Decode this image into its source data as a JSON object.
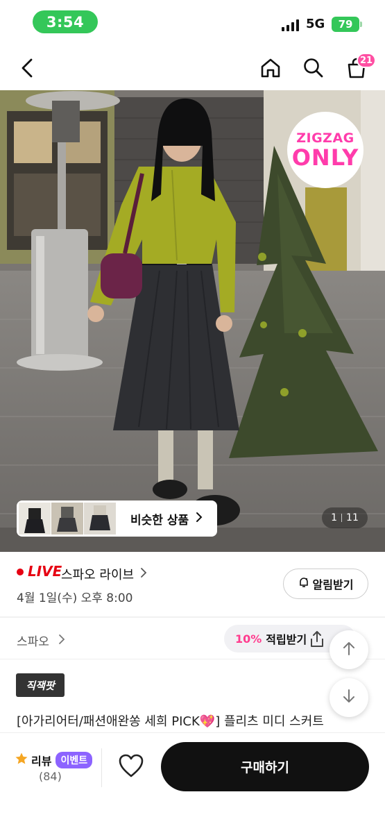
{
  "status_bar": {
    "time": "3:54",
    "network": "5G",
    "battery": "79"
  },
  "nav": {
    "cart_count": "21"
  },
  "hero": {
    "zigzag_line1": "ZIGZAG",
    "zigzag_line2": "ONLY",
    "similar_label": "비슷한 상품",
    "pager_current": "1",
    "pager_total": "11"
  },
  "live": {
    "tag": "LIVE",
    "title": "스파오 라이브",
    "date": "4월 1일(수) 오후 8:00",
    "alarm_label": "알림받기"
  },
  "brand": {
    "name": "스파오",
    "points_percent": "10%",
    "points_label": "적립받기"
  },
  "product": {
    "badge": "직잭팟",
    "name": "[아가리어터/패션애완쏭 세희 PICK💖] 플리츠 미디 스커트"
  },
  "bottom": {
    "review_label": "리뷰",
    "event_label": "이벤트",
    "review_count": "(84)",
    "buy_label": "구매하기"
  },
  "colors": {
    "accent_pink": "#ff3cab",
    "live_red": "#e60012",
    "event_purple": "#8c63ff",
    "status_green": "#34c759"
  }
}
